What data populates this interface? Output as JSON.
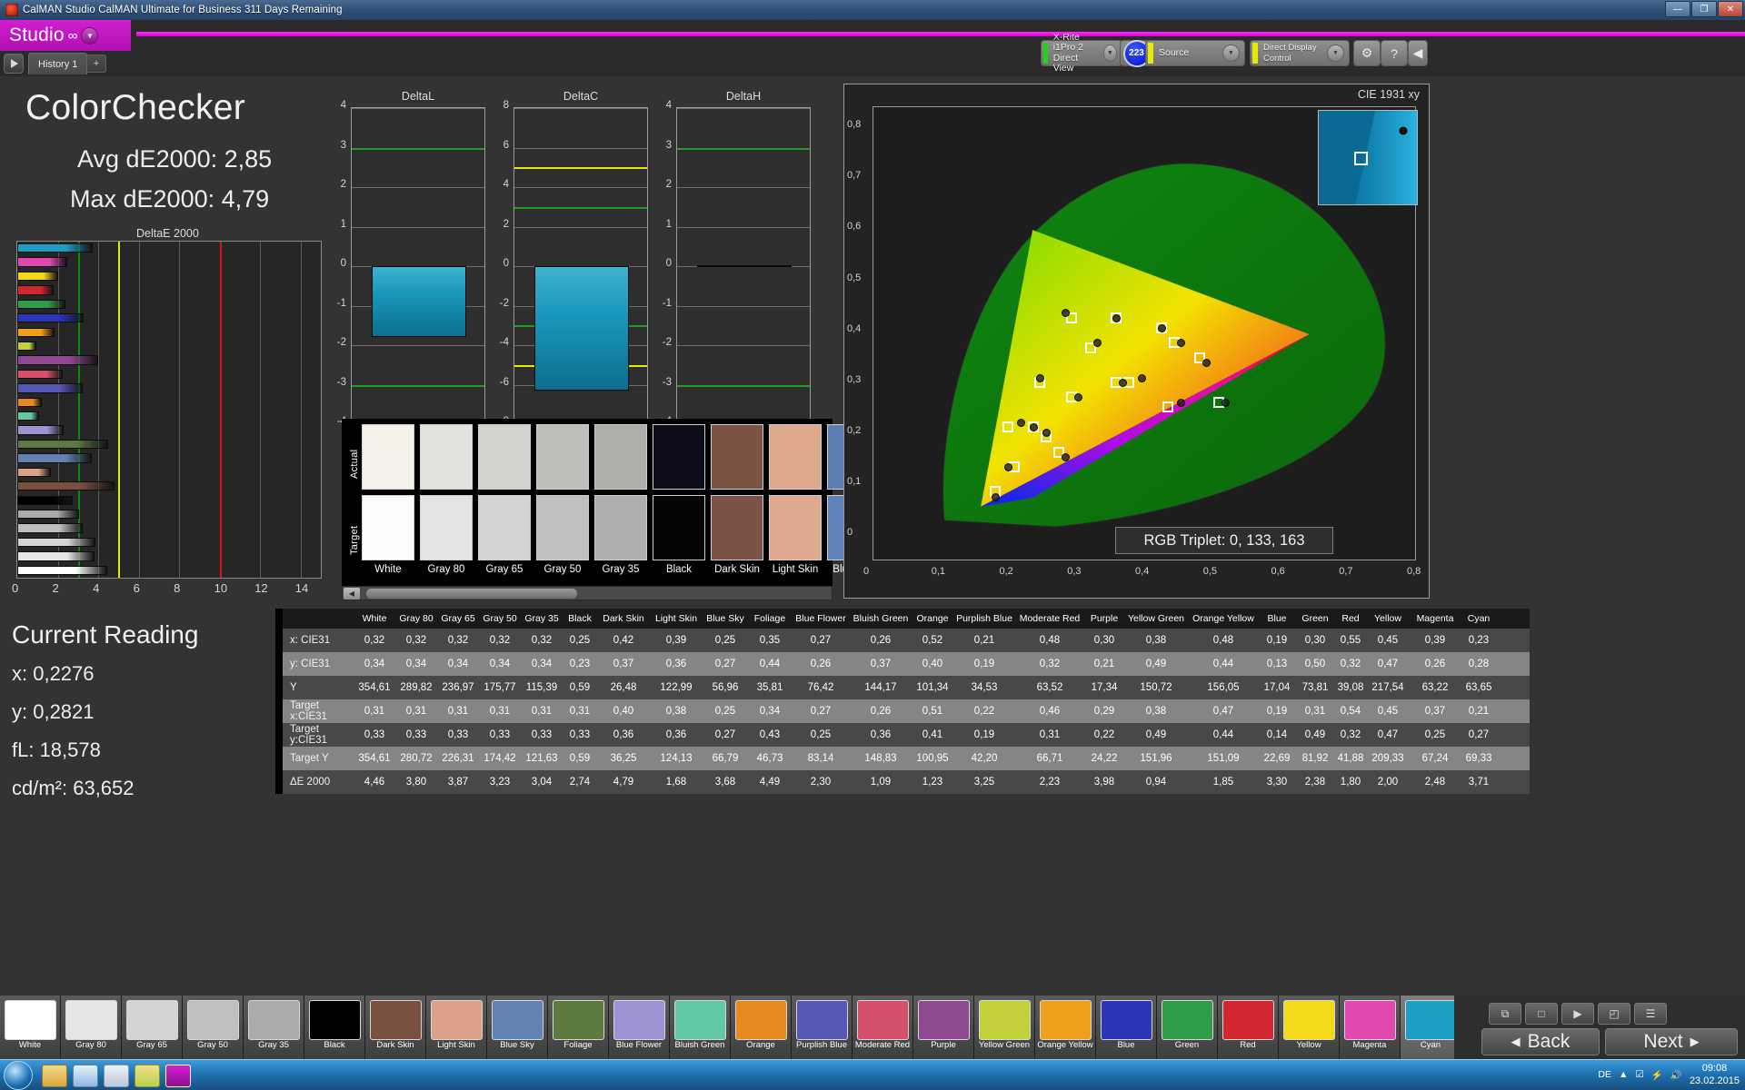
{
  "window": {
    "title": "CalMAN Studio CalMAN Ultimate for Business 311 Days Remaining",
    "minimize": "—",
    "maximize": "❐",
    "close": "✕"
  },
  "brand": {
    "name": "Studio",
    "logo": "∞",
    "caret": "▼"
  },
  "tabs": {
    "play": "▶",
    "history": "History 1",
    "add": "+"
  },
  "toolbar": {
    "meter_name": "X-Rite i1Pro 2",
    "meter_mode": "Direct View",
    "meter_badge": "223",
    "source": "Source",
    "display_control": "Direct Display Control",
    "gear": "⚙",
    "help": "?",
    "back": "◀",
    "caret": "▼"
  },
  "left_panel": {
    "title": "ColorChecker",
    "avg_label": "Avg dE2000: 2,85",
    "max_label": "Max dE2000: 4,79",
    "chart_title": "DeltaE 2000",
    "current_reading_title": "Current Reading",
    "readings": [
      {
        "label": "x: 0,2276"
      },
      {
        "label": "y: 0,2821"
      },
      {
        "label": "fL: 18,578"
      },
      {
        "label": "cd/m²: 63,652"
      }
    ]
  },
  "swatch_panel": {
    "actual_label": "Actual",
    "target_label": "Target",
    "visible_names": [
      "White",
      "Gray 80",
      "Gray 65",
      "Gray 50",
      "Gray 35",
      "Black",
      "Dark Skin",
      "Light Skin",
      "Blue Sky"
    ],
    "actual_colors": [
      "#f5f2ea",
      "#e2e2de",
      "#d2d2cf",
      "#bdbdb9",
      "#adada9",
      "#0d0d19",
      "#7c5244",
      "#dea88c",
      "#5e7fb4"
    ],
    "target_colors": [
      "#fcfcfc",
      "#e4e4e4",
      "#d3d3d3",
      "#bfbfbf",
      "#aeaeae",
      "#050505",
      "#7a5346",
      "#dfa98f",
      "#5f82b9"
    ],
    "scroll_left": "◀"
  },
  "cie": {
    "title": "CIE 1931 xy",
    "rgb_triplet": "RGB Triplet: 0, 133, 163",
    "x_ticks": [
      "0",
      "0,1",
      "0,2",
      "0,3",
      "0,4",
      "0,5",
      "0,6",
      "0,7",
      "0,8"
    ],
    "y_ticks": [
      "0,8",
      "0,7",
      "0,6",
      "0,5",
      "0,4",
      "0,3",
      "0,2",
      "0,1",
      "0"
    ]
  },
  "bottom": {
    "back": "Back",
    "next": "Next",
    "back_arrow": "◀",
    "next_arrow": "▶",
    "icons": [
      "■",
      "□",
      "☰",
      "▭",
      "◉",
      "⧉",
      "◰"
    ],
    "swatches": [
      {
        "name": "White",
        "color": "#ffffff"
      },
      {
        "name": "Gray 80",
        "color": "#e6e6e6"
      },
      {
        "name": "Gray 65",
        "color": "#d4d4d4"
      },
      {
        "name": "Gray 50",
        "color": "#bfbfbf"
      },
      {
        "name": "Gray 35",
        "color": "#ababab"
      },
      {
        "name": "Black",
        "color": "#000000"
      },
      {
        "name": "Dark Skin",
        "color": "#7a5140"
      },
      {
        "name": "Light Skin",
        "color": "#dba189"
      },
      {
        "name": "Blue Sky",
        "color": "#6382b4"
      },
      {
        "name": "Foliage",
        "color": "#5c7a3e"
      },
      {
        "name": "Blue Flower",
        "color": "#9e94d4"
      },
      {
        "name": "Bluish Green",
        "color": "#62c8a7"
      },
      {
        "name": "Orange",
        "color": "#e7891f"
      },
      {
        "name": "Purplish Blue",
        "color": "#5757b5"
      },
      {
        "name": "Moderate Red",
        "color": "#d3516d"
      },
      {
        "name": "Purple",
        "color": "#8e4a90"
      },
      {
        "name": "Yellow Green",
        "color": "#c3d03a"
      },
      {
        "name": "Orange Yellow",
        "color": "#ef9f1c"
      },
      {
        "name": "Blue",
        "color": "#2b35b5"
      },
      {
        "name": "Green",
        "color": "#2f9c4a"
      },
      {
        "name": "Red",
        "color": "#d22630"
      },
      {
        "name": "Yellow",
        "color": "#f2d91a"
      },
      {
        "name": "Magenta",
        "color": "#e04ab0"
      },
      {
        "name": "Cyan",
        "color": "#1b9fc4"
      }
    ],
    "selected_index": 23
  },
  "taskbar": {
    "lang": "DE",
    "time": "09:08",
    "date": "23.02.2015",
    "tray_icons": [
      "▲",
      "☑",
      "⚡",
      "🖧",
      "🔊"
    ]
  },
  "chart_data": [
    {
      "type": "bar",
      "title": "DeltaE 2000",
      "orientation": "horizontal",
      "xlabel": "",
      "ylabel": "",
      "xlim": [
        0,
        15
      ],
      "x_ticks": [
        0,
        2,
        4,
        6,
        8,
        10,
        12,
        14
      ],
      "grid": true,
      "threshold_lines": [
        {
          "value": 3,
          "color": "#0d8a0d"
        },
        {
          "value": 5,
          "color": "#e8e800"
        },
        {
          "value": 10,
          "color": "#d81010"
        }
      ],
      "categories": [
        "Cyan",
        "Magenta",
        "Yellow",
        "Red",
        "Green",
        "Blue",
        "Orange Yellow",
        "Yellow Green",
        "Purple",
        "Moderate Red",
        "Purplish Blue",
        "Orange",
        "Bluish Green",
        "Blue Flower",
        "Foliage",
        "Blue Sky",
        "Light Skin",
        "Dark Skin",
        "Black",
        "Gray 35",
        "Gray 50",
        "Gray 65",
        "Gray 80",
        "White"
      ],
      "bar_colors": [
        "#1b9fc4",
        "#e04ab0",
        "#f2d91a",
        "#d22630",
        "#2f9c4a",
        "#2b35b5",
        "#ef9f1c",
        "#c3d03a",
        "#8e4a90",
        "#d3516d",
        "#5757b5",
        "#e7891f",
        "#62c8a7",
        "#9e94d4",
        "#5c7a3e",
        "#6382b4",
        "#dba189",
        "#7a5140",
        "#000000",
        "#ababab",
        "#bfbfbf",
        "#d4d4d4",
        "#e6e6e6",
        "#ffffff"
      ],
      "values": [
        3.71,
        2.48,
        2.0,
        1.8,
        2.38,
        3.3,
        1.85,
        0.94,
        3.98,
        2.23,
        3.25,
        1.23,
        1.09,
        2.3,
        4.49,
        3.68,
        1.68,
        4.79,
        2.74,
        3.04,
        3.23,
        3.87,
        3.8,
        4.46
      ]
    },
    {
      "type": "bar",
      "title": "DeltaL",
      "ylim": [
        -4,
        4
      ],
      "y_ticks": [
        4,
        3,
        2,
        1,
        0,
        -1,
        -2,
        -3,
        -4
      ],
      "threshold_lines": [
        {
          "value": 3,
          "color": "#1f9e1f"
        },
        {
          "value": -3,
          "color": "#1f9e1f"
        }
      ],
      "categories": [
        "Cyan"
      ],
      "values": [
        -1.8
      ],
      "bar_color": "#1896bb"
    },
    {
      "type": "bar",
      "title": "DeltaC",
      "ylim": [
        -8,
        8
      ],
      "y_ticks": [
        8,
        6,
        4,
        2,
        0,
        -2,
        -4,
        -6,
        -8
      ],
      "threshold_lines": [
        {
          "value": 5,
          "color": "#e8e800"
        },
        {
          "value": 3,
          "color": "#1f9e1f"
        },
        {
          "value": -3,
          "color": "#1f9e1f"
        },
        {
          "value": -5,
          "color": "#e8e800"
        }
      ],
      "categories": [
        "Cyan"
      ],
      "values": [
        -6.3
      ],
      "bar_color": "#1896bb"
    },
    {
      "type": "bar",
      "title": "DeltaH",
      "ylim": [
        -4,
        4
      ],
      "y_ticks": [
        4,
        3,
        2,
        1,
        0,
        -1,
        -2,
        -3,
        -4
      ],
      "threshold_lines": [
        {
          "value": 3,
          "color": "#1f9e1f"
        },
        {
          "value": -3,
          "color": "#1f9e1f"
        }
      ],
      "categories": [
        "Cyan"
      ],
      "values": [
        0.0
      ],
      "bar_color": "#1896bb"
    }
  ],
  "table": {
    "columns": [
      "White",
      "Gray 80",
      "Gray 65",
      "Gray 50",
      "Gray 35",
      "Black",
      "Dark Skin",
      "Light Skin",
      "Blue Sky",
      "Foliage",
      "Blue Flower",
      "Bluish Green",
      "Orange",
      "Purplish Blue",
      "Moderate Red",
      "Purple",
      "Yellow Green",
      "Orange Yellow",
      "Blue",
      "Green",
      "Red",
      "Yellow",
      "Magenta",
      "Cyan"
    ],
    "rows": [
      {
        "label": "x: CIE31",
        "values": [
          "0,32",
          "0,32",
          "0,32",
          "0,32",
          "0,32",
          "0,25",
          "0,42",
          "0,39",
          "0,25",
          "0,35",
          "0,27",
          "0,26",
          "0,52",
          "0,21",
          "0,48",
          "0,30",
          "0,38",
          "0,48",
          "0,19",
          "0,30",
          "0,55",
          "0,45",
          "0,39",
          "0,23"
        ]
      },
      {
        "label": "y: CIE31",
        "values": [
          "0,34",
          "0,34",
          "0,34",
          "0,34",
          "0,34",
          "0,23",
          "0,37",
          "0,36",
          "0,27",
          "0,44",
          "0,26",
          "0,37",
          "0,40",
          "0,19",
          "0,32",
          "0,21",
          "0,49",
          "0,44",
          "0,13",
          "0,50",
          "0,32",
          "0,47",
          "0,26",
          "0,28"
        ]
      },
      {
        "label": "Y",
        "values": [
          "354,61",
          "289,82",
          "236,97",
          "175,77",
          "115,39",
          "0,59",
          "26,48",
          "122,99",
          "56,96",
          "35,81",
          "76,42",
          "144,17",
          "101,34",
          "34,53",
          "63,52",
          "17,34",
          "150,72",
          "156,05",
          "17,04",
          "73,81",
          "39,08",
          "217,54",
          "63,22",
          "63,65"
        ]
      },
      {
        "label": "Target x:CIE31",
        "values": [
          "0,31",
          "0,31",
          "0,31",
          "0,31",
          "0,31",
          "0,31",
          "0,40",
          "0,38",
          "0,25",
          "0,34",
          "0,27",
          "0,26",
          "0,51",
          "0,22",
          "0,46",
          "0,29",
          "0,38",
          "0,47",
          "0,19",
          "0,31",
          "0,54",
          "0,45",
          "0,37",
          "0,21"
        ]
      },
      {
        "label": "Target y:CIE31",
        "values": [
          "0,33",
          "0,33",
          "0,33",
          "0,33",
          "0,33",
          "0,33",
          "0,36",
          "0,36",
          "0,27",
          "0,43",
          "0,25",
          "0,36",
          "0,41",
          "0,19",
          "0,31",
          "0,22",
          "0,49",
          "0,44",
          "0,14",
          "0,49",
          "0,32",
          "0,47",
          "0,25",
          "0,27"
        ]
      },
      {
        "label": "Target Y",
        "values": [
          "354,61",
          "280,72",
          "226,31",
          "174,42",
          "121,63",
          "0,59",
          "36,25",
          "124,13",
          "66,79",
          "46,73",
          "83,14",
          "148,83",
          "100,95",
          "42,20",
          "66,71",
          "24,22",
          "151,96",
          "151,09",
          "22,69",
          "81,92",
          "41,88",
          "209,33",
          "67,24",
          "69,33"
        ]
      },
      {
        "label": "ΔE 2000",
        "values": [
          "4,46",
          "3,80",
          "3,87",
          "3,23",
          "3,04",
          "2,74",
          "4,79",
          "1,68",
          "3,68",
          "4,49",
          "2,30",
          "1,09",
          "1,23",
          "3,25",
          "2,23",
          "3,98",
          "0,94",
          "1,85",
          "3,30",
          "2,38",
          "1,80",
          "2,00",
          "2,48",
          "3,71"
        ]
      }
    ]
  },
  "cie_points": {
    "measured": [
      {
        "x": 0.35,
        "y": 0.44
      },
      {
        "x": 0.3,
        "y": 0.5
      },
      {
        "x": 0.38,
        "y": 0.49
      },
      {
        "x": 0.45,
        "y": 0.47
      },
      {
        "x": 0.48,
        "y": 0.44
      },
      {
        "x": 0.52,
        "y": 0.4
      },
      {
        "x": 0.55,
        "y": 0.32
      },
      {
        "x": 0.48,
        "y": 0.32
      },
      {
        "x": 0.42,
        "y": 0.37
      },
      {
        "x": 0.39,
        "y": 0.36
      },
      {
        "x": 0.26,
        "y": 0.37
      },
      {
        "x": 0.23,
        "y": 0.28
      },
      {
        "x": 0.25,
        "y": 0.27
      },
      {
        "x": 0.32,
        "y": 0.33
      },
      {
        "x": 0.3,
        "y": 0.21
      },
      {
        "x": 0.27,
        "y": 0.26
      },
      {
        "x": 0.21,
        "y": 0.19
      },
      {
        "x": 0.19,
        "y": 0.13
      }
    ],
    "targets": [
      {
        "x": 0.34,
        "y": 0.43
      },
      {
        "x": 0.31,
        "y": 0.49
      },
      {
        "x": 0.38,
        "y": 0.49
      },
      {
        "x": 0.45,
        "y": 0.47
      },
      {
        "x": 0.47,
        "y": 0.44
      },
      {
        "x": 0.51,
        "y": 0.41
      },
      {
        "x": 0.54,
        "y": 0.32
      },
      {
        "x": 0.46,
        "y": 0.31
      },
      {
        "x": 0.4,
        "y": 0.36
      },
      {
        "x": 0.38,
        "y": 0.36
      },
      {
        "x": 0.26,
        "y": 0.36
      },
      {
        "x": 0.21,
        "y": 0.27
      },
      {
        "x": 0.25,
        "y": 0.27
      },
      {
        "x": 0.31,
        "y": 0.33
      },
      {
        "x": 0.29,
        "y": 0.22
      },
      {
        "x": 0.27,
        "y": 0.25
      },
      {
        "x": 0.22,
        "y": 0.19
      },
      {
        "x": 0.19,
        "y": 0.14
      }
    ]
  }
}
